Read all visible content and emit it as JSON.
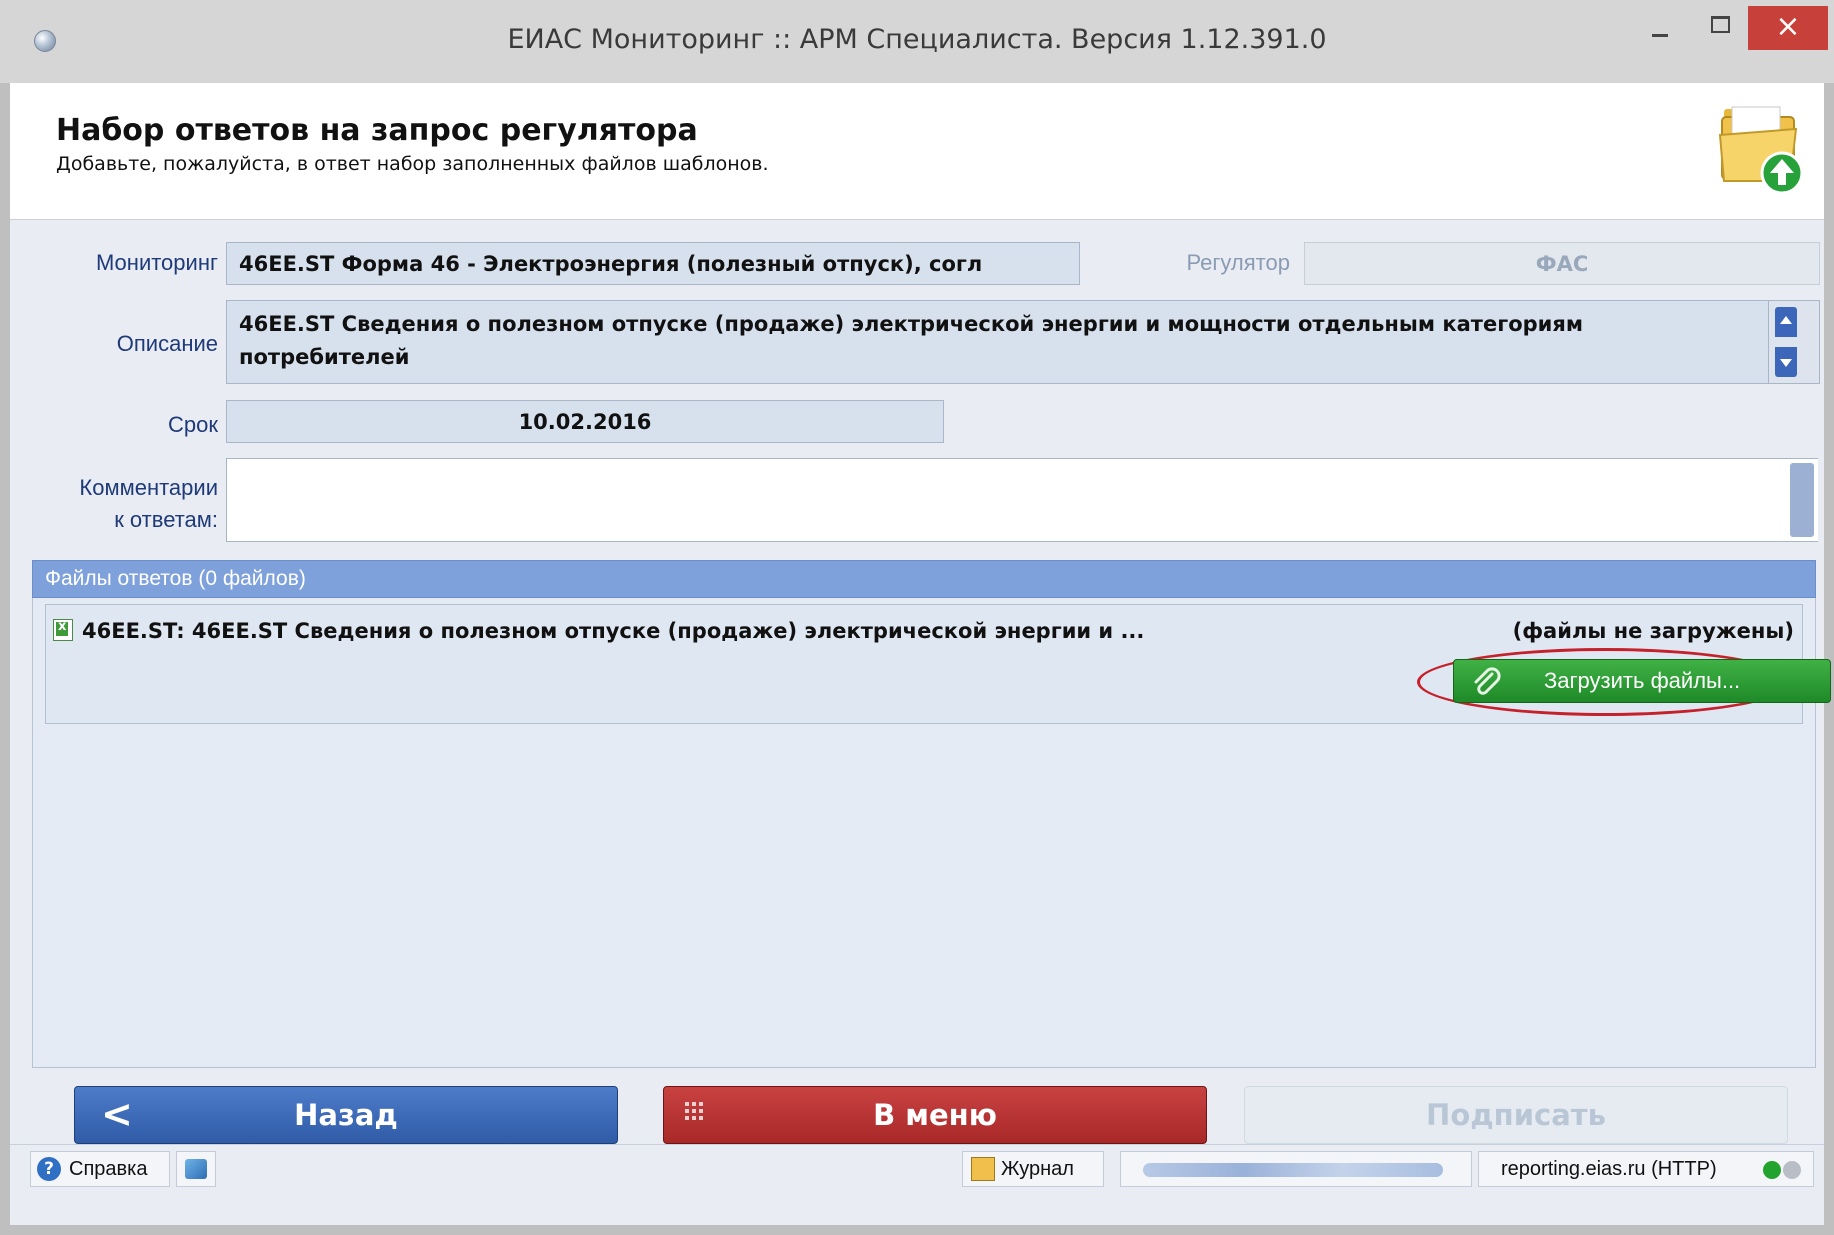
{
  "window": {
    "title": "ЕИАС Мониторинг :: АРМ Специалиста. Версия 1.12.391.0",
    "close_glyph": "×"
  },
  "header": {
    "title": "Набор ответов на запрос регулятора",
    "subtitle": "Добавьте, пожалуйста, в ответ набор заполненных файлов шаблонов."
  },
  "form": {
    "monitoring_label": "Мониторинг",
    "monitoring_value": "46EE.ST  Форма 46 - Электроэнергия (полезный отпуск), согл",
    "regulator_label": "Регулятор",
    "regulator_value": "ФАС",
    "description_label": "Описание",
    "description_value": "46EE.ST  Сведения о полезном отпуске (продаже) электрической энергии и мощности отдельным категориям потребителей",
    "deadline_label": "Срок",
    "deadline_value": "10.02.2016",
    "comments_label_line1": "Комментарии",
    "comments_label_line2": "к ответам:",
    "comments_value": ""
  },
  "files": {
    "header": "Файлы ответов (0 файлов)",
    "items": [
      {
        "name": "46EE.ST: 46EE.ST Сведения о полезном отпуске (продаже) электрической энергии и ...",
        "status": "(файлы не загружены)",
        "upload_label": "Загрузить файлы..."
      }
    ]
  },
  "buttons": {
    "back": "Назад",
    "back_glyph": "<",
    "menu": "В меню",
    "sign": "Подписать"
  },
  "statusbar": {
    "help": "Справка",
    "journal": "Журнал",
    "server": "reporting.eias.ru (HTTP)"
  },
  "colors": {
    "accent_blue": "#2f5ba7",
    "menu_red": "#a82828",
    "upload_green": "#1e8a28",
    "highlight_ring": "#c6202a"
  }
}
